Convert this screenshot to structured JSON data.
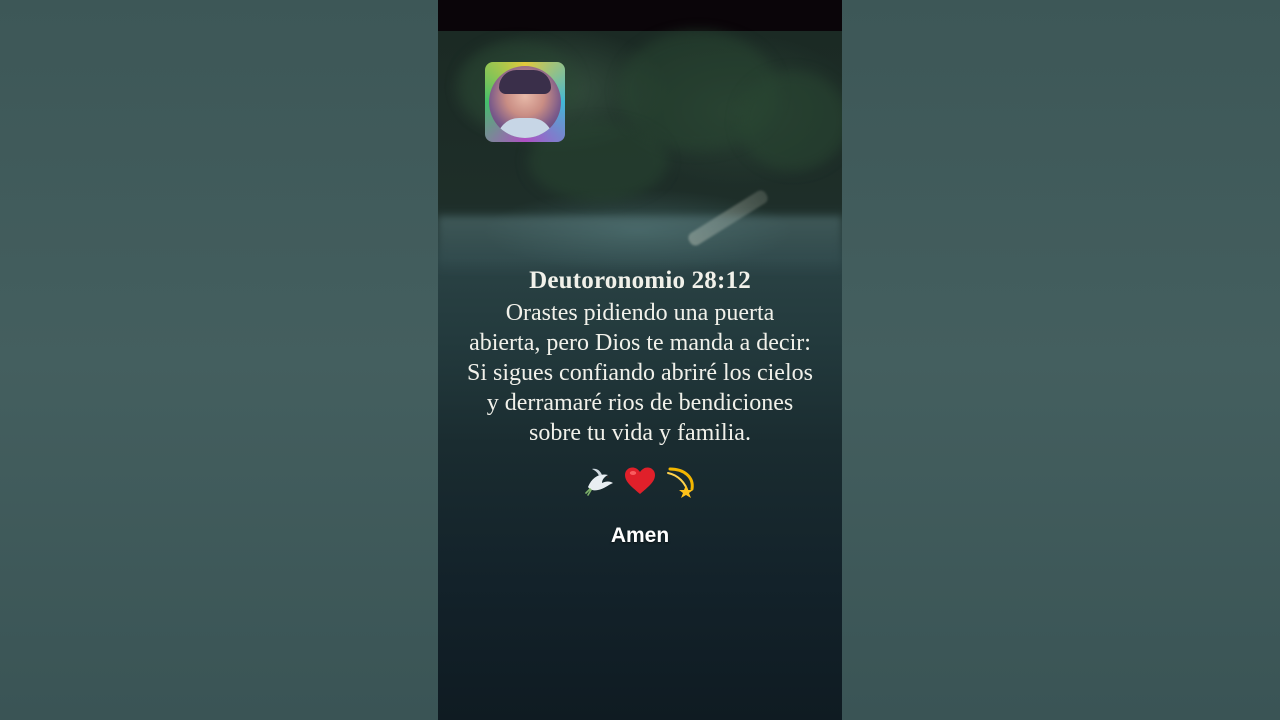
{
  "verse": {
    "title": "Deutoronomio 28:12",
    "lines": [
      "Orastes pidiendo una puerta",
      "abierta, pero Dios te manda a decir:",
      "Si sigues confiando abriré los cielos",
      "y derramaré rios de bendiciones",
      "sobre tu vida y familia."
    ]
  },
  "emojis": [
    "dove-icon",
    "heart-icon",
    "dizzy-star-icon"
  ],
  "caption": "Amen",
  "colors": {
    "text": "#f1f1ea",
    "heart": "#e0202a",
    "star": "#f2b600",
    "background": "#3f5a5a",
    "topbar": "#0a0509"
  }
}
